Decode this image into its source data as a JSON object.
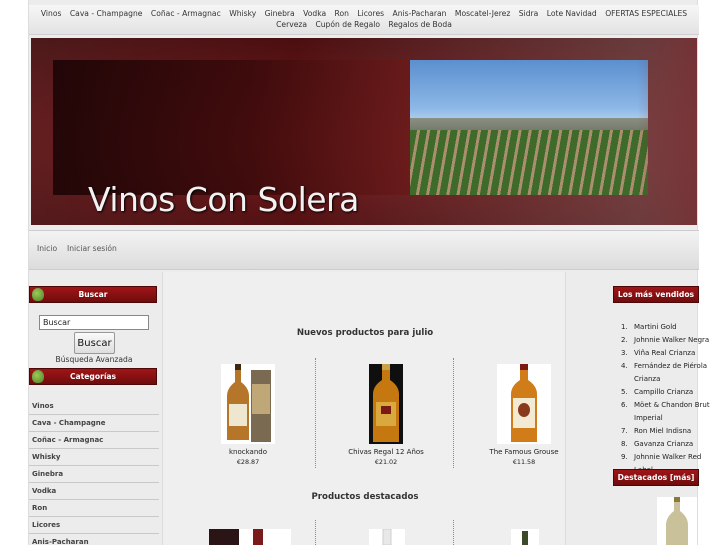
{
  "top_nav": {
    "row1": [
      "Vinos",
      "Cava - Champagne",
      "Coñac - Armagnac",
      "Whisky",
      "Ginebra",
      "Vodka",
      "Ron",
      "Licores",
      "Anis-Pacharan",
      "Moscatel-Jerez",
      "Sidra",
      "Lote Navidad",
      "OFERTAS ESPECIALES"
    ],
    "row2": [
      "Cerveza",
      "Cupón de Regalo",
      "Regalos de Boda"
    ]
  },
  "banner": {
    "title": "Vinos Con Solera"
  },
  "sub_nav": {
    "home": "Inicio",
    "login": "Iniciar sesión"
  },
  "search": {
    "heading": "Buscar",
    "input_value": "Buscar",
    "button_label": "Buscar",
    "advanced_link": "Búsqueda Avanzada"
  },
  "categories": {
    "heading": "Categorías",
    "items": [
      "Vinos",
      "Cava - Champagne",
      "Coñac - Armagnac",
      "Whisky",
      "Ginebra",
      "Vodka",
      "Ron",
      "Licores",
      "Anis-Pacharan"
    ]
  },
  "new_products": {
    "heading": "Nuevos productos para julio",
    "items": [
      {
        "name": "knockando",
        "price": "€28.87"
      },
      {
        "name": "Chivas Regal 12 Años",
        "price": "€21.02"
      },
      {
        "name": "The Famous Grouse",
        "price": "€11.58"
      }
    ]
  },
  "featured_products": {
    "heading": "Productos destacados"
  },
  "best_sellers": {
    "heading": "Los más vendidos",
    "items": [
      {
        "num": "1.",
        "name": "Martini Gold"
      },
      {
        "num": "2.",
        "name": "Johnnie Walker Negra"
      },
      {
        "num": "3.",
        "name": "Viña Real Crianza"
      },
      {
        "num": "4.",
        "name": "Fernández de Piérola Crianza"
      },
      {
        "num": "5.",
        "name": "Campillo Crianza"
      },
      {
        "num": "6.",
        "name": "Möet & Chandon Brut Imperial"
      },
      {
        "num": "7.",
        "name": "Ron Miel Indisna"
      },
      {
        "num": "8.",
        "name": "Gavanza Crianza"
      },
      {
        "num": "9.",
        "name": "Johnnie Walker Red Label"
      }
    ]
  },
  "featured_side": {
    "heading": "Destacados  [más]"
  },
  "colors": {
    "box_header": "#8b1214",
    "page_bg": "#ececec"
  }
}
